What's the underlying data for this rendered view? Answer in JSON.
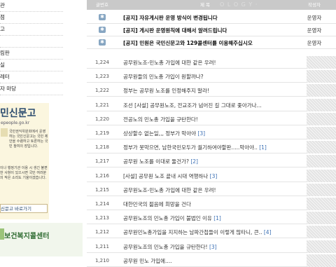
{
  "sidebar": {
    "menu": [
      {
        "label": "관"
      },
      {
        "label": "점"
      },
      {
        "label": "고"
      },
      {
        "label": ""
      },
      {
        "label": "림판"
      },
      {
        "label": "실"
      },
      {
        "label": "레터"
      },
      {
        "label": "자 마당"
      }
    ],
    "minwon": {
      "title": "민신문고",
      "url": "epeople.go.kr",
      "desc": "국민권익위원회에서 운영하는 국민신문고는 국민 제안을 수렴하고 토론하는 국민 참여의 장입니다.",
      "desc2": "이나 행정기관 이용 시 생긴 불편한 사항이 있으시면 국민 여러분의 작은 소리도 기울이겠습니다.",
      "button": "신문고 바로가기"
    },
    "bokji": {
      "title": "보건복지콜센터",
      "subtitle": ""
    }
  },
  "board": {
    "headers": {
      "num": "글번호",
      "title": "제 목",
      "author": "작성자"
    },
    "header_pattern": "O L O G Y ·",
    "notices": [
      {
        "title": "[공지] 자유게시판 운영 방식이 변경됩니다",
        "author": "운영자"
      },
      {
        "title": "[공지] 게시판 운영원칙에 대해서 알려드립니다",
        "author": "운영자"
      },
      {
        "title": "[공지] 민원은 국민신문고와 129콜센터를 이용해주십시오",
        "author": "운영자"
      }
    ],
    "posts": [
      {
        "num": "1,224",
        "title": "공무원노조-민노총 가입에 대한 같은 우려!",
        "comments": ""
      },
      {
        "num": "1,223",
        "title": "공무원들의 민노총 가입이 원할까나?",
        "comments": ""
      },
      {
        "num": "1,222",
        "title": "정부는 공무원 노조를 인정해주지 말라!",
        "comments": ""
      },
      {
        "num": "1,221",
        "title": "조선 [사설] 공무원노조, 전교조가 넘어진 길 그대로 좇아가나...",
        "comments": ""
      },
      {
        "num": "1,220",
        "title": "전공노의 민노총 가입을 규탄한다!",
        "comments": ""
      },
      {
        "num": "1,219",
        "title": "상상할수 없는일,,, 정부가 막아야",
        "comments": "[3]"
      },
      {
        "num": "1,218",
        "title": "정부가 못막으면, 남한국민모두가 궐기하여야할판.....막아야..",
        "comments": "[1]"
      },
      {
        "num": "1,217",
        "title": "공무원 노조를 이대로 둘건가?",
        "comments": "[2]"
      },
      {
        "num": "1,216",
        "title": "[사설] 공무원 노조 끝내 시대 역행하나",
        "comments": "[3]"
      },
      {
        "num": "1,215",
        "title": "공무원노조-민노총 가입에 대한 같은 우려!",
        "comments": ""
      },
      {
        "num": "1,214",
        "title": "대한민국의 젊음에 희망을 건다",
        "comments": ""
      },
      {
        "num": "1,213",
        "title": "공무원노조의 민노총 가입이 불법인 이유",
        "comments": "[1]"
      },
      {
        "num": "1,212",
        "title": "공무원민노총가입을 지지하는 남파간첩들이 이렇게 많타니, 큰..",
        "comments": "[4]"
      },
      {
        "num": "1,211",
        "title": "공무원노조의 민노총 가입을 규탄한다!",
        "comments": "[3]"
      },
      {
        "num": "1,210",
        "title": "공무원 민노 가입에....",
        "comments": ""
      }
    ]
  }
}
